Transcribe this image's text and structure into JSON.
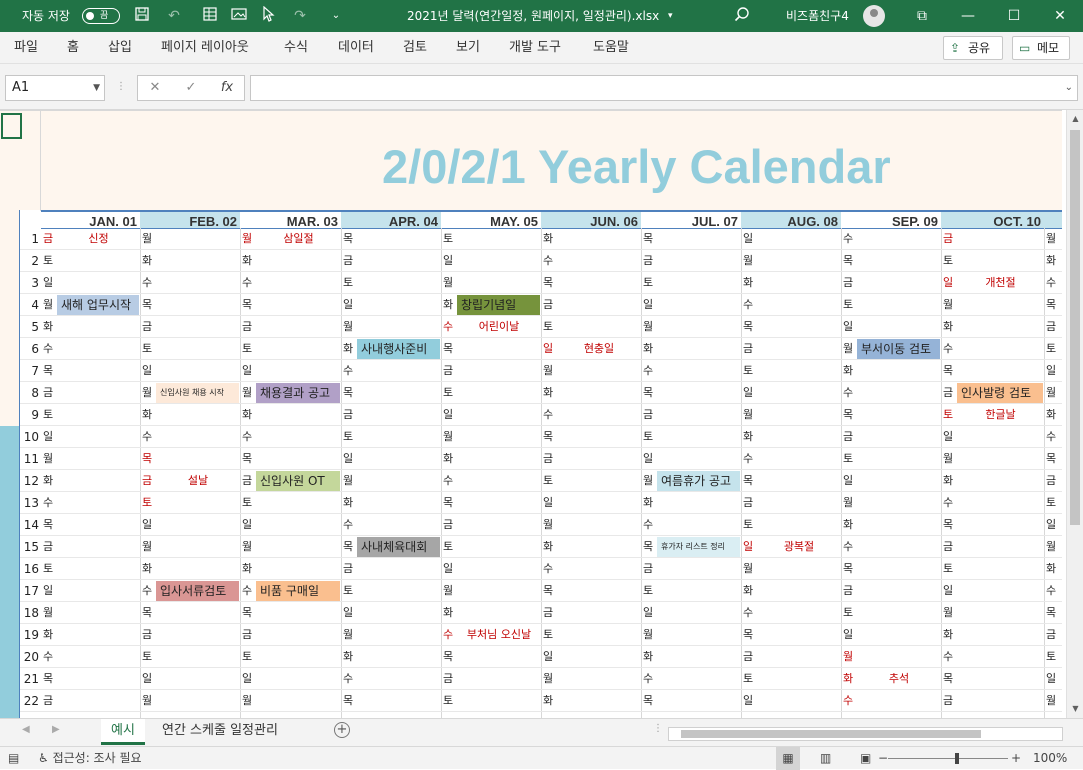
{
  "titlebar": {
    "autosave_label": "자동 저장",
    "autosave_state": "끔",
    "filename": "2021년 달력(연간일정, 원페이지, 일정관리).xlsx",
    "user": "비즈폼친구4"
  },
  "menu": [
    "파일",
    "홈",
    "삽입",
    "페이지 레이아웃",
    "수식",
    "데이터",
    "검토",
    "보기",
    "개발 도구",
    "도움말"
  ],
  "share_label": "공유",
  "memo_label": "메모",
  "formula_bar": {
    "name_box": "A1",
    "fx": "fx",
    "formula": ""
  },
  "calendar_title": "2/0/2/1 Yearly Calendar",
  "months": [
    "JAN. 01",
    "FEB. 02",
    "MAR. 03",
    "APR. 04",
    "MAY. 05",
    "JUN. 06",
    "JUL. 07",
    "AUG. 08",
    "SEP. 09",
    "OCT. 10"
  ],
  "row_numbers": [
    "1",
    "2",
    "3",
    "4",
    "5",
    "6",
    "7",
    "8",
    "9",
    "10",
    "11",
    "12",
    "13",
    "14",
    "15",
    "16",
    "17",
    "18",
    "19",
    "20",
    "21",
    "22"
  ],
  "weekdays": [
    [
      "금",
      "월",
      "월",
      "목",
      "토",
      "화",
      "목",
      "일",
      "수",
      "금",
      "월"
    ],
    [
      "토",
      "화",
      "화",
      "금",
      "일",
      "수",
      "금",
      "월",
      "목",
      "토",
      "화"
    ],
    [
      "일",
      "수",
      "수",
      "토",
      "월",
      "목",
      "토",
      "화",
      "금",
      "일",
      "수"
    ],
    [
      "월",
      "목",
      "목",
      "일",
      "화",
      "금",
      "일",
      "수",
      "토",
      "월",
      "목"
    ],
    [
      "화",
      "금",
      "금",
      "월",
      "수",
      "토",
      "월",
      "목",
      "일",
      "화",
      "금"
    ],
    [
      "수",
      "토",
      "토",
      "화",
      "목",
      "일",
      "화",
      "금",
      "월",
      "수",
      "토"
    ],
    [
      "목",
      "일",
      "일",
      "수",
      "금",
      "월",
      "수",
      "토",
      "화",
      "목",
      "일"
    ],
    [
      "금",
      "월",
      "월",
      "목",
      "토",
      "화",
      "목",
      "일",
      "수",
      "금",
      "월"
    ],
    [
      "토",
      "화",
      "화",
      "금",
      "일",
      "수",
      "금",
      "월",
      "목",
      "토",
      "화"
    ],
    [
      "일",
      "수",
      "수",
      "토",
      "월",
      "목",
      "토",
      "화",
      "금",
      "일",
      "수"
    ],
    [
      "월",
      "목",
      "목",
      "일",
      "화",
      "금",
      "일",
      "수",
      "토",
      "월",
      "목"
    ],
    [
      "화",
      "금",
      "금",
      "월",
      "수",
      "토",
      "월",
      "목",
      "일",
      "화",
      "금"
    ],
    [
      "수",
      "토",
      "토",
      "화",
      "목",
      "일",
      "화",
      "금",
      "월",
      "수",
      "토"
    ],
    [
      "목",
      "일",
      "일",
      "수",
      "금",
      "월",
      "수",
      "토",
      "화",
      "목",
      "일"
    ],
    [
      "금",
      "월",
      "월",
      "목",
      "토",
      "화",
      "목",
      "일",
      "수",
      "금",
      "월"
    ],
    [
      "토",
      "화",
      "화",
      "금",
      "일",
      "수",
      "금",
      "월",
      "목",
      "토",
      "화"
    ],
    [
      "일",
      "수",
      "수",
      "토",
      "월",
      "목",
      "토",
      "화",
      "금",
      "일",
      "수"
    ],
    [
      "월",
      "목",
      "목",
      "일",
      "화",
      "금",
      "일",
      "수",
      "토",
      "월",
      "목"
    ],
    [
      "화",
      "금",
      "금",
      "월",
      "수",
      "토",
      "월",
      "목",
      "일",
      "화",
      "금"
    ],
    [
      "수",
      "토",
      "토",
      "화",
      "목",
      "일",
      "화",
      "금",
      "월",
      "수",
      "토"
    ],
    [
      "목",
      "일",
      "일",
      "수",
      "금",
      "월",
      "수",
      "토",
      "화",
      "목",
      "일"
    ],
    [
      "금",
      "월",
      "월",
      "목",
      "토",
      "화",
      "목",
      "일",
      "수",
      "금",
      "월"
    ]
  ],
  "red_days": [
    [
      0,
      0
    ],
    [
      0,
      2
    ],
    [
      4,
      4
    ],
    [
      5,
      5
    ],
    [
      10,
      1
    ],
    [
      11,
      1
    ],
    [
      12,
      1
    ],
    [
      14,
      7
    ],
    [
      18,
      4
    ],
    [
      19,
      8
    ],
    [
      20,
      8
    ],
    [
      21,
      8
    ],
    [
      0,
      9
    ],
    [
      2,
      9
    ],
    [
      8,
      9
    ]
  ],
  "holidays": [
    {
      "row": 0,
      "col": 0,
      "text": "신정"
    },
    {
      "row": 0,
      "col": 2,
      "text": "삼일절"
    },
    {
      "row": 2,
      "col": 9,
      "text": "개천절"
    },
    {
      "row": 4,
      "col": 4,
      "text": "어린이날"
    },
    {
      "row": 5,
      "col": 5,
      "text": "현충일"
    },
    {
      "row": 8,
      "col": 9,
      "text": "한글날"
    },
    {
      "row": 11,
      "col": 1,
      "text": "설날"
    },
    {
      "row": 14,
      "col": 7,
      "text": "광복절"
    },
    {
      "row": 18,
      "col": 4,
      "text": "부처님 오신날"
    },
    {
      "row": 20,
      "col": 8,
      "text": "추석"
    }
  ],
  "events": [
    {
      "row": 3,
      "col": 0,
      "text": "새해 업무시작",
      "color": "#b8cce4"
    },
    {
      "row": 3,
      "col": 4,
      "text": "창립기념일",
      "color": "#76933c"
    },
    {
      "row": 5,
      "col": 3,
      "text": "사내행사준비",
      "color": "#92cddc"
    },
    {
      "row": 5,
      "col": 8,
      "text": "부서이동 검토",
      "color": "#95b3d7"
    },
    {
      "row": 7,
      "col": 1,
      "text": "신입사원 채용 시작",
      "color": "#fde9d9",
      "small": true
    },
    {
      "row": 7,
      "col": 2,
      "text": "채용결과 공고",
      "color": "#b1a0c7"
    },
    {
      "row": 7,
      "col": 9,
      "text": "인사발령 검토",
      "color": "#fabf8f"
    },
    {
      "row": 11,
      "col": 2,
      "text": "신입사원 OT",
      "color": "#c4d79b"
    },
    {
      "row": 11,
      "col": 6,
      "text": "여름휴가 공고",
      "color": "#c5e3ec"
    },
    {
      "row": 14,
      "col": 3,
      "text": "사내체육대회",
      "color": "#a6a6a6"
    },
    {
      "row": 14,
      "col": 6,
      "text": "휴가자 리스트 정리",
      "color": "#daeef3",
      "small": true
    },
    {
      "row": 16,
      "col": 1,
      "text": "입사서류검토",
      "color": "#da9694"
    },
    {
      "row": 16,
      "col": 2,
      "text": "비품 구매일",
      "color": "#fabf8f"
    }
  ],
  "sheet_tabs": [
    "예시",
    "연간 스케줄 일정관리"
  ],
  "status": {
    "accessibility": "접근성: 조사 필요",
    "zoom": "100%"
  }
}
